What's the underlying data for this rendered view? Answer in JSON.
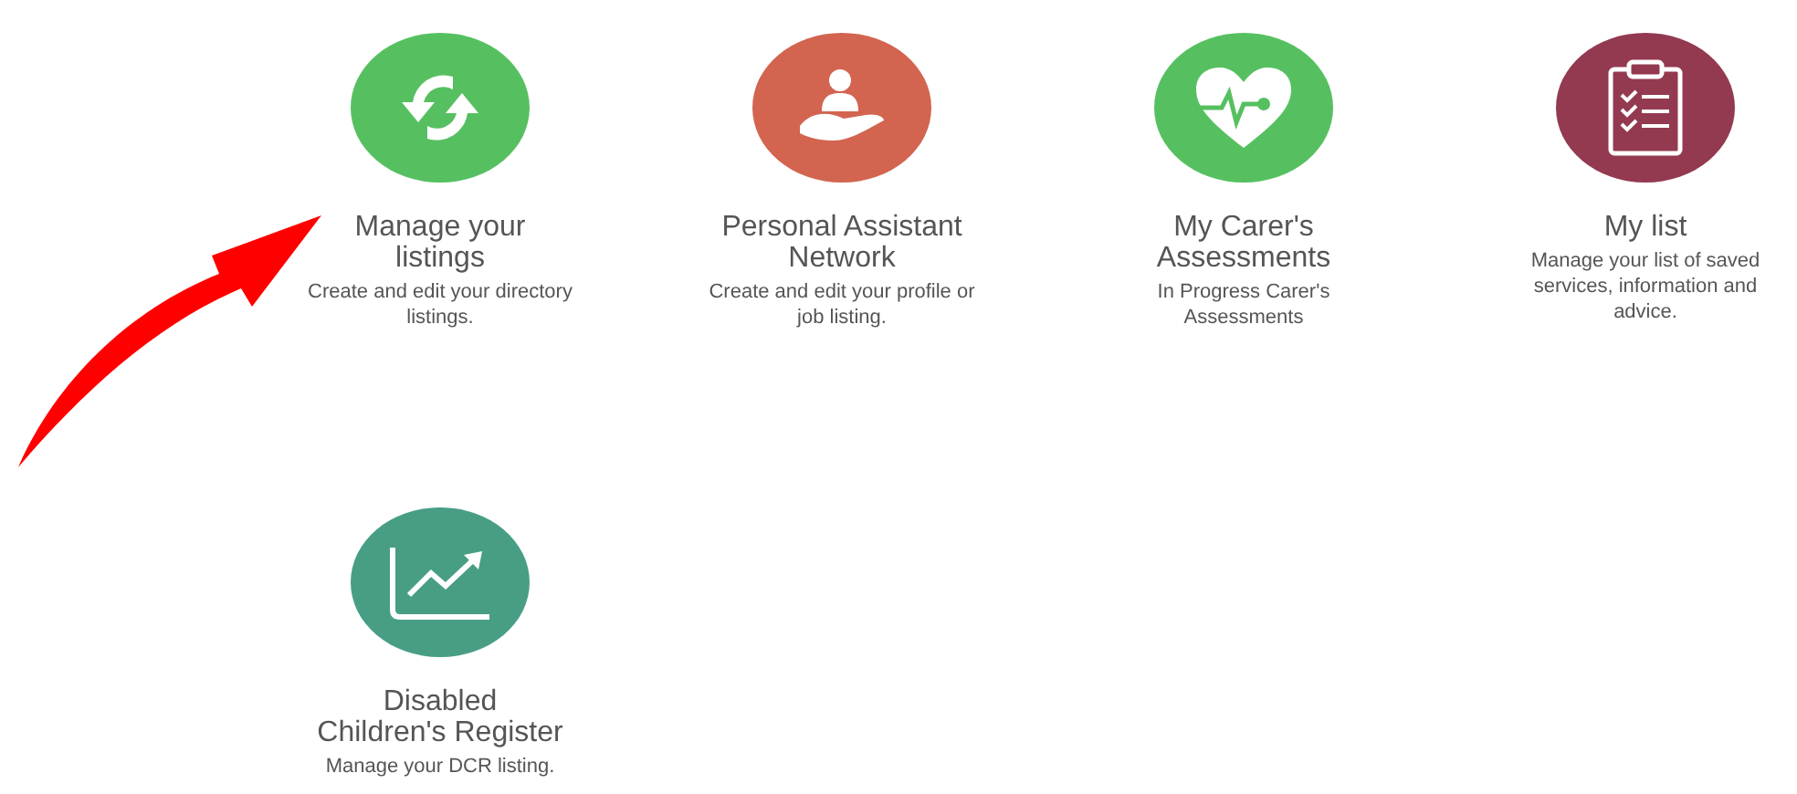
{
  "tiles": [
    {
      "title": "Manage your listings",
      "description": "Create and edit your directory listings.",
      "kind": "sync",
      "color": "#56c060"
    },
    {
      "title": "Personal Assistant Network",
      "description": "Create and edit your profile or job listing.",
      "kind": "care",
      "color": "#d26450"
    },
    {
      "title": "My Carer's Assessments",
      "description": "In Progress Carer's Assessments",
      "kind": "heart",
      "color": "#56c060"
    },
    {
      "title": "My list",
      "description": "Manage your list of saved services, information and advice.",
      "kind": "clipboard",
      "color": "#933a50"
    },
    {
      "title": "Disabled Children's Register",
      "description": "Manage your DCR listing.",
      "kind": "chart",
      "color": "#479e85"
    }
  ]
}
